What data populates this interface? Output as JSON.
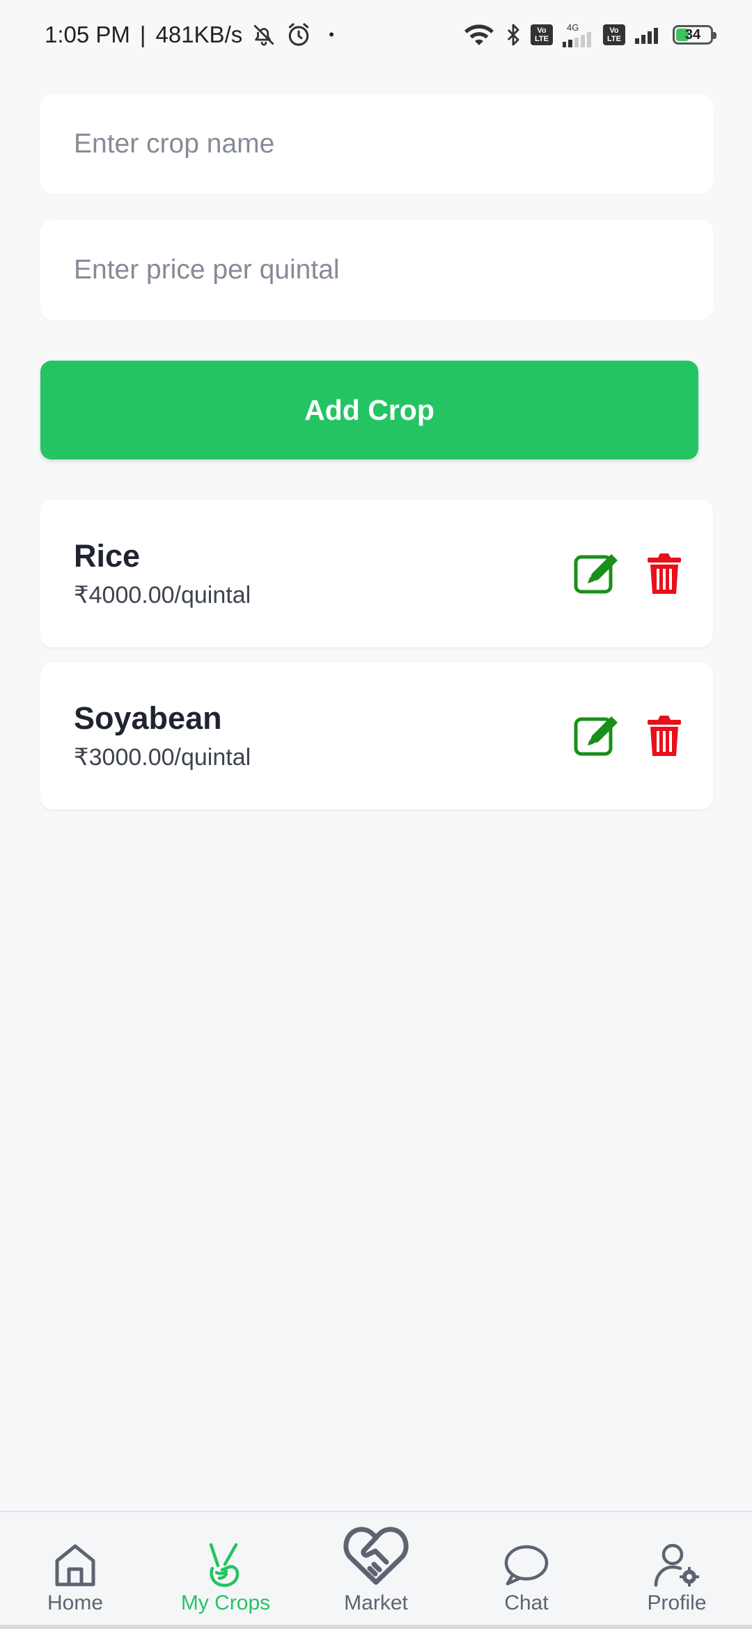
{
  "status_bar": {
    "time": "1:05 PM",
    "separator": "|",
    "speed": "481KB/s",
    "dot": "•",
    "network_type": "4G",
    "battery": "34"
  },
  "form": {
    "crop_name_placeholder": "Enter crop name",
    "crop_name_value": "",
    "price_placeholder": "Enter price per quintal",
    "price_value": "",
    "add_button_label": "Add Crop"
  },
  "crops": [
    {
      "name": "Rice",
      "price": "₹4000.00/quintal"
    },
    {
      "name": "Soyabean",
      "price": "₹3000.00/quintal"
    }
  ],
  "nav": {
    "items": [
      {
        "label": "Home",
        "icon": "home-icon"
      },
      {
        "label": "My Crops",
        "icon": "crops-icon",
        "active": true
      },
      {
        "label": "Market",
        "icon": "handshake-heart-icon"
      },
      {
        "label": "Chat",
        "icon": "chat-bubble-icon"
      },
      {
        "label": "Profile",
        "icon": "profile-settings-icon"
      }
    ]
  },
  "colors": {
    "accent": "#25c462",
    "edit_icon": "#1a8f1a",
    "delete_icon": "#e8101a",
    "background": "#f7f8fa"
  }
}
